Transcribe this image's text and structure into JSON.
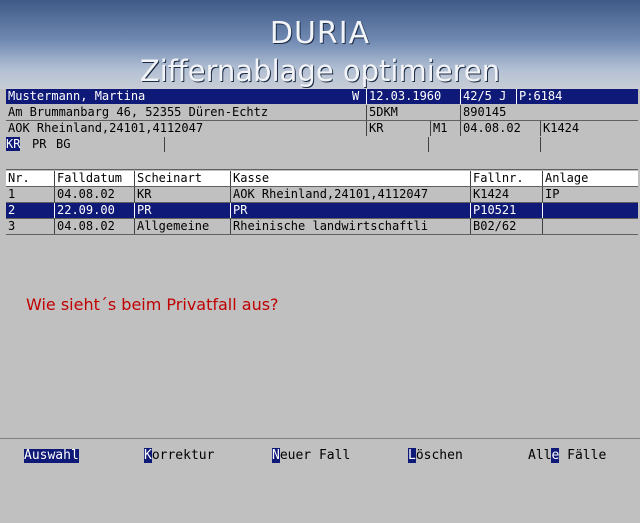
{
  "app": {
    "name": "DURIA",
    "subtitle": "Ziffernablage optimieren"
  },
  "patient": {
    "name": "Mustermann, Martina",
    "sex": "W",
    "birthdate": "12.03.1960",
    "age": "42/5 J",
    "patient_no": "P:6184",
    "address": "Am Brummanbarg 46, 52355 Düren-Echtz",
    "insurance_code": "5DKM",
    "insurance_id": "890145",
    "kasse": "AOK Rheinland,24101,4112047",
    "kasse_type": "KR",
    "member": "M1",
    "date": "04.08.02",
    "case_ref": "K1424",
    "case_types": [
      "KR",
      "PR",
      "BG"
    ]
  },
  "cases": {
    "headers": [
      "Nr.",
      "Falldatum",
      "Scheinart",
      "Kasse",
      "Fallnr.",
      "Anlage"
    ],
    "rows": [
      {
        "nr": "1",
        "datum": "04.08.02",
        "schein": "KR",
        "kasse": "AOK Rheinland,24101,4112047",
        "fallnr": "K1424",
        "anlage": "IP"
      },
      {
        "nr": "2",
        "datum": "22.09.00",
        "schein": "PR",
        "kasse": "PR",
        "fallnr": "P10521",
        "anlage": ""
      },
      {
        "nr": "3",
        "datum": "04.08.02",
        "schein": "Allgemeine",
        "kasse": "Rheinische landwirtschaftli",
        "fallnr": "B02/62",
        "anlage": ""
      }
    ],
    "selected_index": 1
  },
  "question": "Wie sieht´s beim Privatfall aus?",
  "footer": {
    "auswahl": "Auswahl",
    "korrektur_key": "K",
    "korrektur_rest": "orrektur",
    "neuer_key": "N",
    "neuer_rest": "euer Fall",
    "loeschen_key": "L",
    "loeschen_rest": "öschen",
    "alle_pre": "All",
    "alle_key": "e",
    "alle_rest": " Fälle"
  },
  "colors": {
    "selection": "#0f1a78",
    "question": "#c00000",
    "background": "#c0c0c0"
  }
}
